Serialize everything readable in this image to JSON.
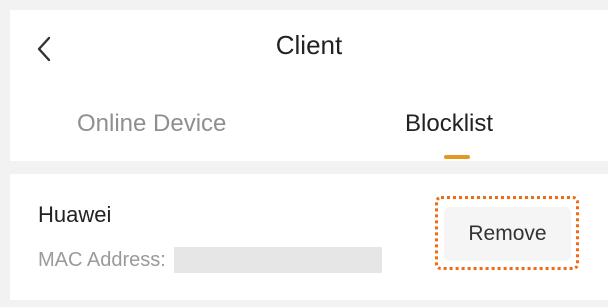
{
  "header": {
    "title": "Client",
    "back_icon": "chevron-left-icon"
  },
  "tabs": [
    {
      "label": "Online Device",
      "active": false
    },
    {
      "label": "Blocklist",
      "active": true
    }
  ],
  "colors": {
    "accent": "#e59722",
    "highlight": "#ef6c12"
  },
  "blocklist": {
    "items": [
      {
        "name": "Huawei",
        "mac_label": "MAC Address:",
        "action_label": "Remove"
      }
    ]
  }
}
